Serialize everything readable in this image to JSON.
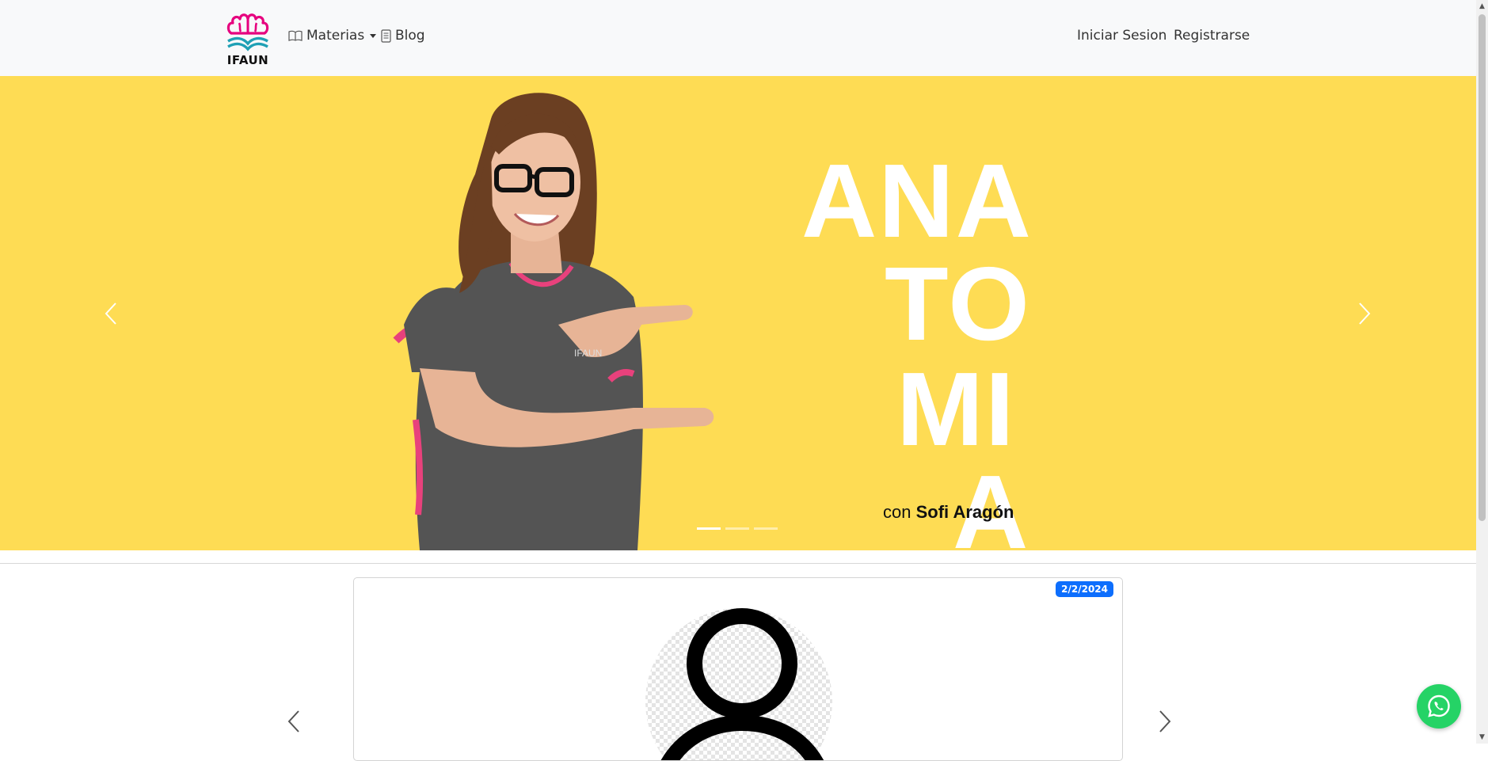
{
  "brand": {
    "name": "IFAUN",
    "logo_icon": "brain-book-logo",
    "colors": {
      "magenta": "#e6007e",
      "teal": "#1fa0b5"
    }
  },
  "nav": {
    "materias_label": "Materias",
    "materias_icon": "book-open-icon",
    "blog_label": "Blog",
    "blog_icon": "document-icon",
    "login_label": "Iniciar Sesion",
    "register_label": "Registrarse"
  },
  "hero": {
    "background": "#fedc54",
    "words": [
      "ANA",
      "TO",
      "MI",
      "A"
    ],
    "subtitle_prefix": "con",
    "subtitle_name": "Sofi Aragón",
    "slide_count": 3,
    "active_slide": 1
  },
  "card": {
    "date": "2/2/2024",
    "avatar_icon": "user-placeholder-icon"
  },
  "whatsapp": {
    "icon": "whatsapp-icon",
    "color": "#25d366"
  }
}
